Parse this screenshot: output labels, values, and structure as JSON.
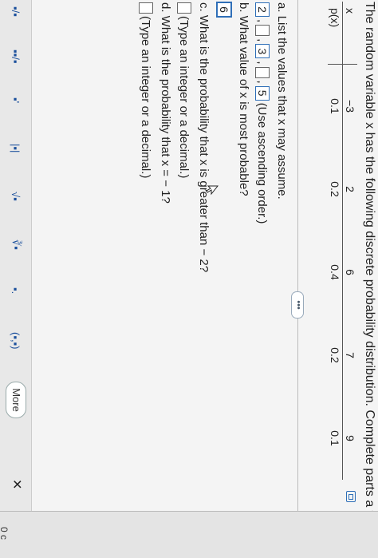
{
  "question": {
    "title": "The random variable x has the following discrete probability distribution. Complete parts a through d."
  },
  "table": {
    "x_label": "x",
    "p_label": "p(x)",
    "x_values": [
      "−3",
      "2",
      "6",
      "7",
      "9"
    ],
    "p_values": [
      "0.1",
      "0.2",
      "0.4",
      "0.2",
      "0.1"
    ]
  },
  "more_dots": "•••",
  "part_a": {
    "prompt": "a. List the values that x may assume.",
    "answers": [
      "2",
      "",
      "3",
      "",
      "5"
    ],
    "hint": "(Use ascending order.)"
  },
  "part_b": {
    "prompt": "b. What value of x is most probable?",
    "answer": "6"
  },
  "part_c": {
    "prompt": "c. What is the probability that x is greater than − 2?",
    "hint": "(Type an integer or a decimal.)"
  },
  "part_d": {
    "prompt": "d. What is the probability that x = − 1?",
    "hint": "(Type an integer or a decimal.)"
  },
  "toolbar": {
    "items": [
      "▪/▪",
      "▪▪/▪",
      "▪'",
      "|▪|",
      "√▪",
      "∛▪",
      "▪.",
      "(▪,▪)"
    ],
    "more_label": "More",
    "close_symbol": "✕"
  },
  "side": {
    "label": "0 c"
  }
}
